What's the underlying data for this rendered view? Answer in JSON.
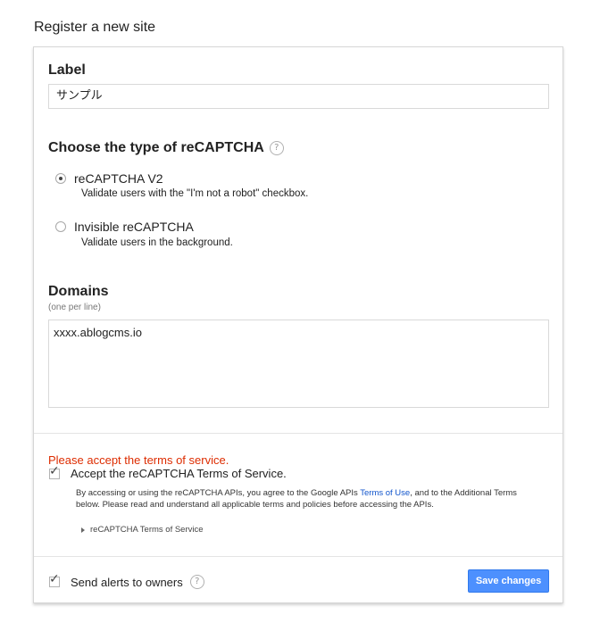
{
  "page": {
    "title": "Register a new site"
  },
  "label_section": {
    "heading": "Label",
    "value": "サンプル"
  },
  "type_section": {
    "heading": "Choose the type of reCAPTCHA",
    "help_icon": "?",
    "options": [
      {
        "label": "reCAPTCHA V2",
        "description": "Validate users with the \"I'm not a robot\" checkbox.",
        "selected": true
      },
      {
        "label": "Invisible reCAPTCHA",
        "description": "Validate users in the background.",
        "selected": false
      }
    ]
  },
  "domains_section": {
    "heading": "Domains",
    "hint": "(one per line)",
    "value": "xxxx.ablogcms.io"
  },
  "terms": {
    "error": "Please accept the terms of service.",
    "accept_label": "Accept the reCAPTCHA Terms of Service.",
    "accept_checked": true,
    "body_before_link": "By accessing or using the reCAPTCHA APIs, you agree to the Google APIs ",
    "link_text": "Terms of Use",
    "body_after_link": ", and to the Additional Terms below. Please read and understand all applicable terms and policies before accessing the APIs.",
    "toggle_label": "reCAPTCHA Terms of Service"
  },
  "footer": {
    "alerts_label": "Send alerts to owners",
    "alerts_checked": true,
    "help_icon": "?",
    "save_label": "Save changes"
  },
  "colors": {
    "error": "#dd2c00",
    "save_button": "#4d90fe",
    "link": "#1155cc"
  },
  "icons": {
    "radio_selected": "radio-checked-icon",
    "checkbox_checked": "checkmark-icon",
    "help": "question-circle-icon",
    "disclosure": "triangle-right-icon"
  }
}
